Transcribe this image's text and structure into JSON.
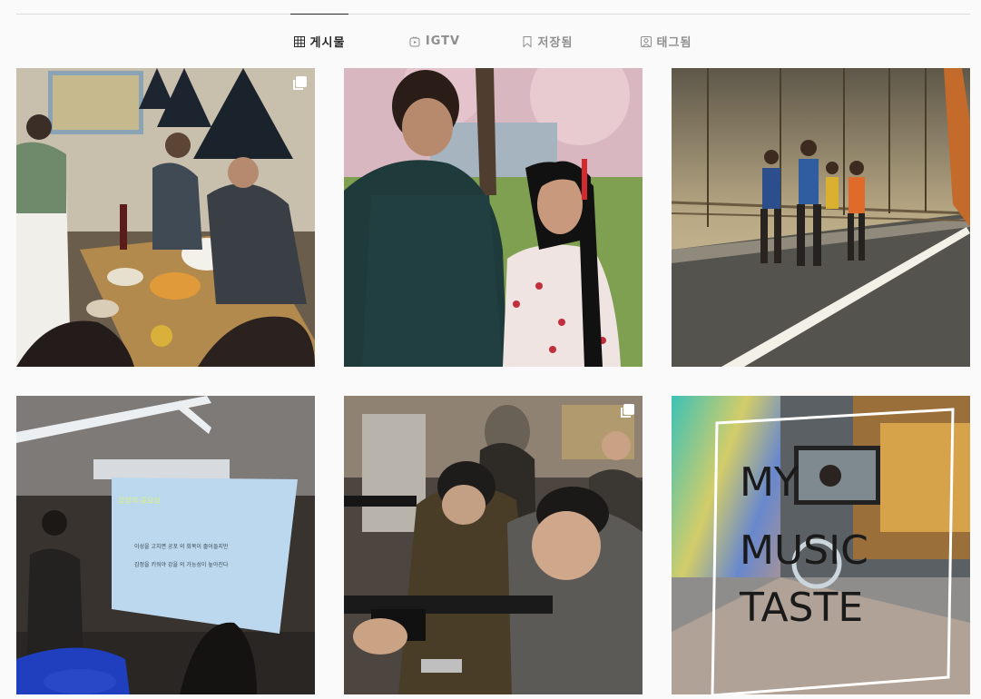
{
  "tabs": [
    {
      "label": "게시물",
      "icon": "grid-icon",
      "active": true
    },
    {
      "label": "IGTV",
      "icon": "igtv-icon",
      "active": false
    },
    {
      "label": "저장됨",
      "icon": "bookmark-icon",
      "active": false
    },
    {
      "label": "태그됨",
      "icon": "tagged-user-icon",
      "active": false
    }
  ],
  "posts": [
    {
      "description": "dinner party",
      "multi": true
    },
    {
      "description": "movie still couple",
      "multi": false
    },
    {
      "description": "marathon runners on bridge",
      "multi": false
    },
    {
      "description": "lecture presentation",
      "multi": false,
      "slide_title": "감정의 중요성",
      "slide_line1": "이성을 고치면  공포  의 회복이 줄어들지만",
      "slide_line2": "감정을 키워야  강을  의 가능성이 높아진다"
    },
    {
      "description": "shooting range",
      "multi": true
    },
    {
      "description": "music taste poster",
      "multi": false,
      "poster_line1": "MY",
      "poster_line2": "MUSIC",
      "poster_line3": "TASTE"
    }
  ],
  "colors": {
    "active_tab": "#262626",
    "inactive_tab": "#8e8e8e",
    "background": "#fafafa",
    "divider": "#dbdbdb"
  }
}
